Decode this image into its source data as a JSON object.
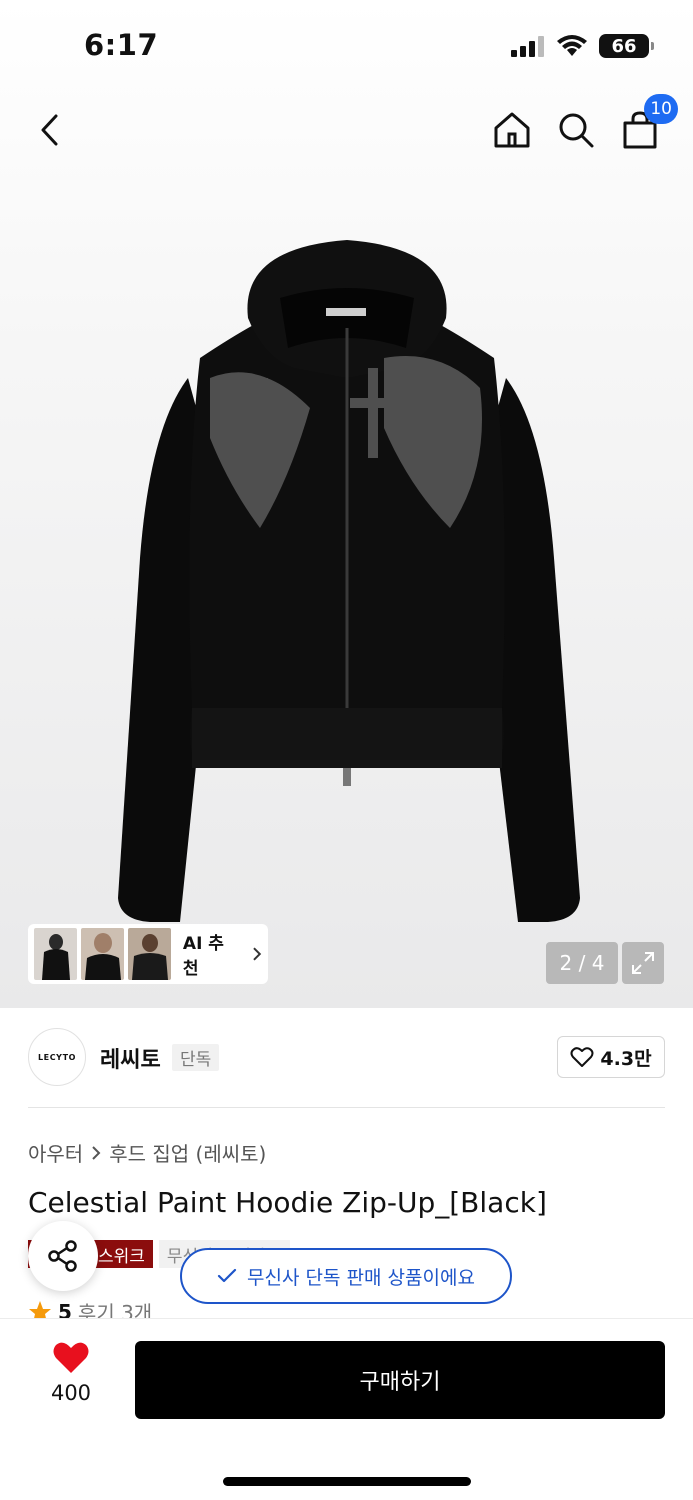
{
  "status_bar": {
    "time": "6:17",
    "battery": "66"
  },
  "header": {
    "cart_count": "10"
  },
  "gallery": {
    "ai_label": "AI 추천",
    "page_counter": "2 / 4"
  },
  "brand": {
    "logo_text": "LECYTO",
    "name": "레씨토",
    "tag": "단독",
    "likes": "4.3만"
  },
  "breadcrumb": {
    "category": "아우터",
    "subcategory": "후드 집업 (레씨토)"
  },
  "product": {
    "title": "Celestial Paint Hoodie Zip-Up_[Black]",
    "tags": [
      "스위크",
      "무신사 스탠다드"
    ],
    "rating": "5",
    "reviews": "후기 3개"
  },
  "toast": {
    "message": "무신사 단독 판매 상품이에요"
  },
  "bottom": {
    "wish_count": "400",
    "buy_label": "구매하기"
  },
  "colors": {
    "accent_blue": "#1e6bf2",
    "heart_red": "#e8101e",
    "tag_red": "#8b0d0d",
    "star": "#f59a0c"
  }
}
